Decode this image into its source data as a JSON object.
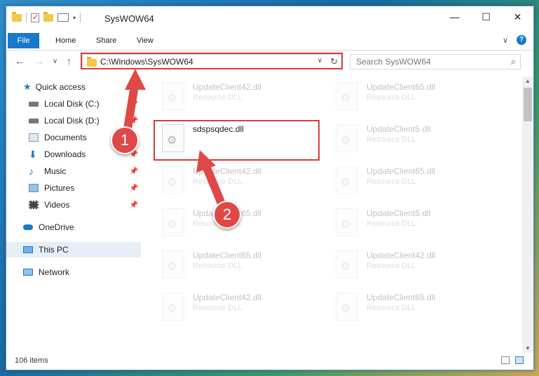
{
  "window": {
    "title": "SysWOW64",
    "controls": {
      "minimize": "—",
      "maximize": "☐",
      "close": "✕"
    }
  },
  "ribbon": {
    "tabs": [
      "File",
      "Home",
      "Share",
      "View"
    ],
    "expand": "∨",
    "help": "?"
  },
  "nav": {
    "back": "←",
    "forward": "→",
    "recent": "∨",
    "up": "↑"
  },
  "address": {
    "path": "C:\\Windows\\SysWOW64",
    "dropdown": "∨",
    "refresh": "↻"
  },
  "search": {
    "placeholder": "Search SysWOW64",
    "icon": "⌕"
  },
  "sidebar": {
    "items": [
      {
        "label": "Quick access",
        "icon": "star-icon",
        "color": "#1979ca",
        "pinned": false
      },
      {
        "label": "Local Disk (C:)",
        "icon": "drive-icon",
        "color": "#666666",
        "pinned": true
      },
      {
        "label": "Local Disk (D:)",
        "icon": "drive-icon",
        "color": "#666666",
        "pinned": true
      },
      {
        "label": "Documents",
        "icon": "documents-icon",
        "color": "#8a9bb0",
        "pinned": true
      },
      {
        "label": "Downloads",
        "icon": "downloads-icon",
        "color": "#1979ca",
        "pinned": true
      },
      {
        "label": "Music",
        "icon": "music-icon",
        "color": "#1979ca",
        "pinned": true
      },
      {
        "label": "Pictures",
        "icon": "pictures-icon",
        "color": "#5b8fc5",
        "pinned": true
      },
      {
        "label": "Videos",
        "icon": "videos-icon",
        "color": "#444444",
        "pinned": true
      },
      {
        "label": "OneDrive",
        "icon": "cloud-icon",
        "color": "#1979ca",
        "pinned": false
      },
      {
        "label": "This PC",
        "icon": "computer-icon",
        "color": "#1979ca",
        "pinned": false,
        "selected": true
      },
      {
        "label": "Network",
        "icon": "network-icon",
        "color": "#1979ca",
        "pinned": false
      }
    ]
  },
  "files": [
    {
      "name": "UpdateClient42.dll",
      "type": "Resource DLL"
    },
    {
      "name": "UpdateClient65.dll",
      "type": "Resource DLL"
    },
    {
      "name": "sdspsqdec.dll",
      "type": ""
    },
    {
      "name": "UpdateClient5.dll",
      "type": "Resource DLL"
    },
    {
      "name": "UpdateClient42.dll",
      "type": "Resource DLL"
    },
    {
      "name": "UpdateClient65.dll",
      "type": "Resource DLL"
    },
    {
      "name": "UpdateClient65.dll",
      "type": "Resource DLL"
    },
    {
      "name": "UpdateClient5.dll",
      "type": "Resource DLL"
    },
    {
      "name": "UpdateClient65.dll",
      "type": "Resource DLL"
    },
    {
      "name": "UpdateClient42.dll",
      "type": "Resource DLL"
    },
    {
      "name": "UpdateClient42.dll",
      "type": "Resource DLL"
    },
    {
      "name": "UpdateClient65.dll",
      "type": "Resource DLL"
    }
  ],
  "status": {
    "item_count": "106 items"
  },
  "annotations": {
    "step1": "1",
    "step2": "2",
    "color": "#e04848"
  }
}
